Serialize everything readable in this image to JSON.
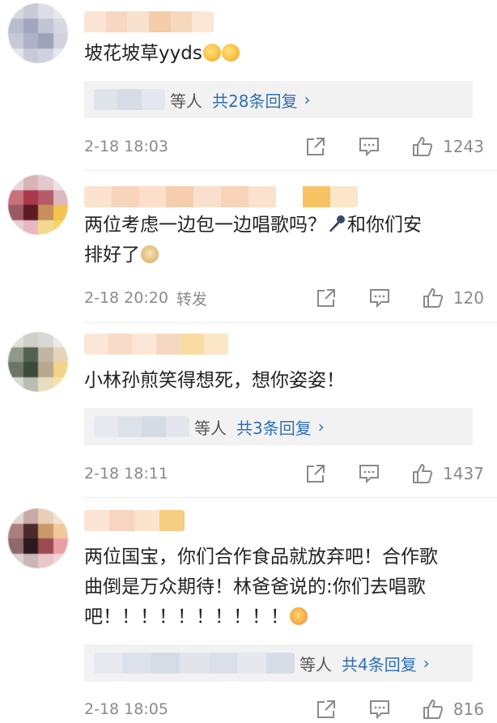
{
  "comments": [
    {
      "text": "坡花坡草yyds",
      "reply": {
        "deng": "等人",
        "link": "共28条回复",
        "arrow": "›"
      },
      "time": "2-18 18:03",
      "forward": "",
      "likes": "1243"
    },
    {
      "text_line1": "两位考虑一边包一边唱歌吗？",
      "text_line1b": "和你们安",
      "text_line2": "排好了",
      "time": "2-18 20:20",
      "forward": "转发",
      "likes": "120"
    },
    {
      "text": "小林孙煎笑得想死，想你姿姿！",
      "reply": {
        "deng": "等人",
        "link": "共3条回复",
        "arrow": "›"
      },
      "time": "2-18 18:11",
      "forward": "",
      "likes": "1437"
    },
    {
      "text_line1": "两位国宝，你们合作食品就放弃吧！合作歌",
      "text_line2": "曲倒是万众期待！林爸爸说的:你们去唱歌",
      "text_line3": "吧！！！！！！！！！！",
      "reply": {
        "deng": "等人",
        "link": "共4条回复",
        "arrow": "›"
      },
      "time": "2-18 18:05",
      "forward": "",
      "likes": "816"
    }
  ],
  "colors": {
    "link": "#2f6fb6",
    "meta": "#8a8a8a",
    "reply_bg": "#f2f2f2"
  },
  "icons": [
    "share-icon",
    "comment-icon",
    "like-icon"
  ]
}
